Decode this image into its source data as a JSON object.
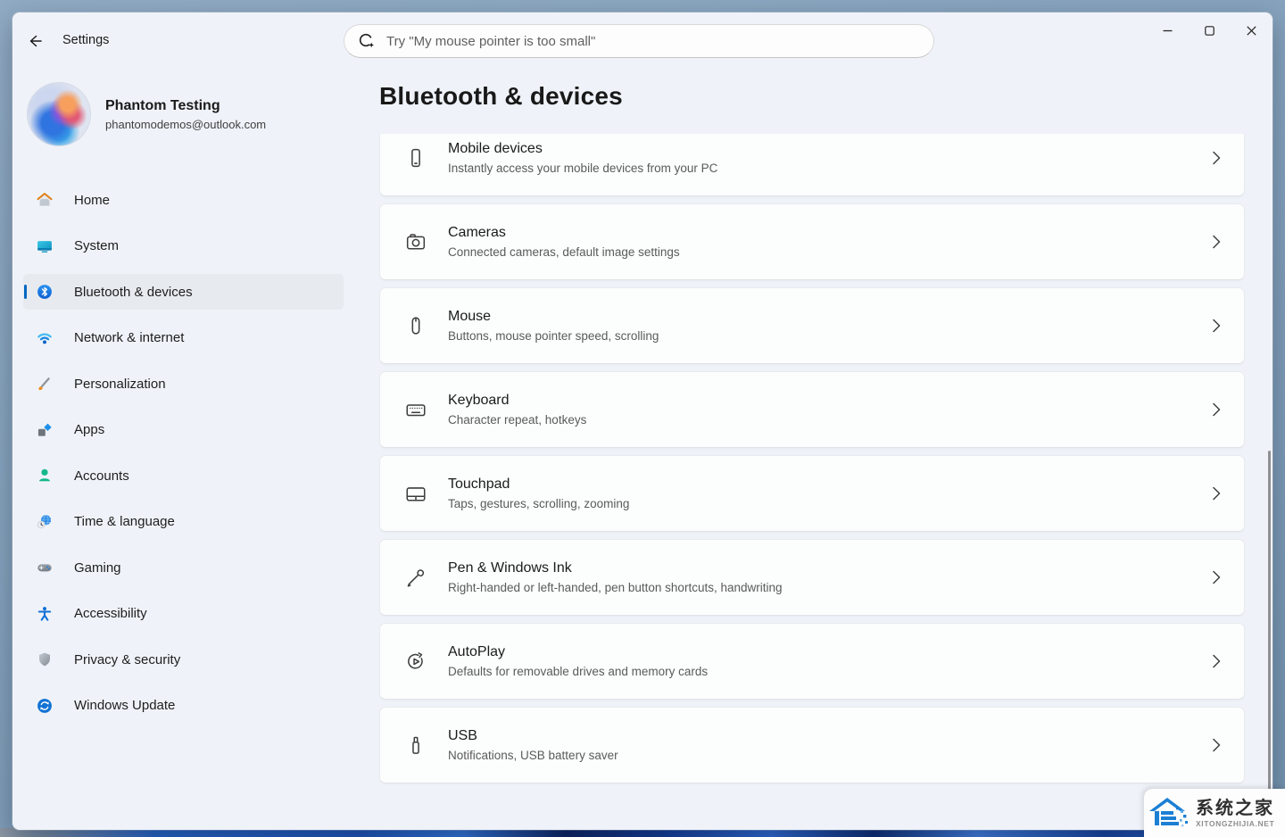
{
  "titlebar": {
    "app_title": "Settings",
    "search_placeholder": "Try \"My mouse pointer is too small\""
  },
  "account": {
    "name": "Phantom Testing",
    "email": "phantomodemos@outlook.com"
  },
  "sidebar": {
    "items": [
      {
        "label": "Home",
        "icon": "home-icon",
        "selected": false
      },
      {
        "label": "System",
        "icon": "system-icon",
        "selected": false
      },
      {
        "label": "Bluetooth & devices",
        "icon": "bluetooth-icon",
        "selected": true
      },
      {
        "label": "Network & internet",
        "icon": "network-icon",
        "selected": false
      },
      {
        "label": "Personalization",
        "icon": "personalization-icon",
        "selected": false
      },
      {
        "label": "Apps",
        "icon": "apps-icon",
        "selected": false
      },
      {
        "label": "Accounts",
        "icon": "accounts-icon",
        "selected": false
      },
      {
        "label": "Time & language",
        "icon": "time-language-icon",
        "selected": false
      },
      {
        "label": "Gaming",
        "icon": "gaming-icon",
        "selected": false
      },
      {
        "label": "Accessibility",
        "icon": "accessibility-icon",
        "selected": false
      },
      {
        "label": "Privacy & security",
        "icon": "privacy-icon",
        "selected": false
      },
      {
        "label": "Windows Update",
        "icon": "windows-update-icon",
        "selected": false
      }
    ]
  },
  "page": {
    "title": "Bluetooth & devices"
  },
  "cards": [
    {
      "title": "Mobile devices",
      "subtitle": "Instantly access your mobile devices from your PC",
      "icon": "mobile-devices-icon"
    },
    {
      "title": "Cameras",
      "subtitle": "Connected cameras, default image settings",
      "icon": "camera-icon"
    },
    {
      "title": "Mouse",
      "subtitle": "Buttons, mouse pointer speed, scrolling",
      "icon": "mouse-icon"
    },
    {
      "title": "Keyboard",
      "subtitle": "Character repeat, hotkeys",
      "icon": "keyboard-icon"
    },
    {
      "title": "Touchpad",
      "subtitle": "Taps, gestures, scrolling, zooming",
      "icon": "touchpad-icon"
    },
    {
      "title": "Pen & Windows Ink",
      "subtitle": "Right-handed or left-handed, pen button shortcuts, handwriting",
      "icon": "pen-icon"
    },
    {
      "title": "AutoPlay",
      "subtitle": "Defaults for removable drives and memory cards",
      "icon": "autoplay-icon"
    },
    {
      "title": "USB",
      "subtitle": "Notifications, USB battery saver",
      "icon": "usb-icon"
    }
  ],
  "watermark": {
    "name": "系统之家",
    "domain": "XITONGZHIJIA.NET"
  },
  "colors": {
    "accent": "#0067c0",
    "window_bg": "#eff3f9",
    "card_bg": "#fcfdfd",
    "selected_pill": "#e7ebf0",
    "title_text": "#191919",
    "subtitle_text": "#5a5a5a"
  }
}
